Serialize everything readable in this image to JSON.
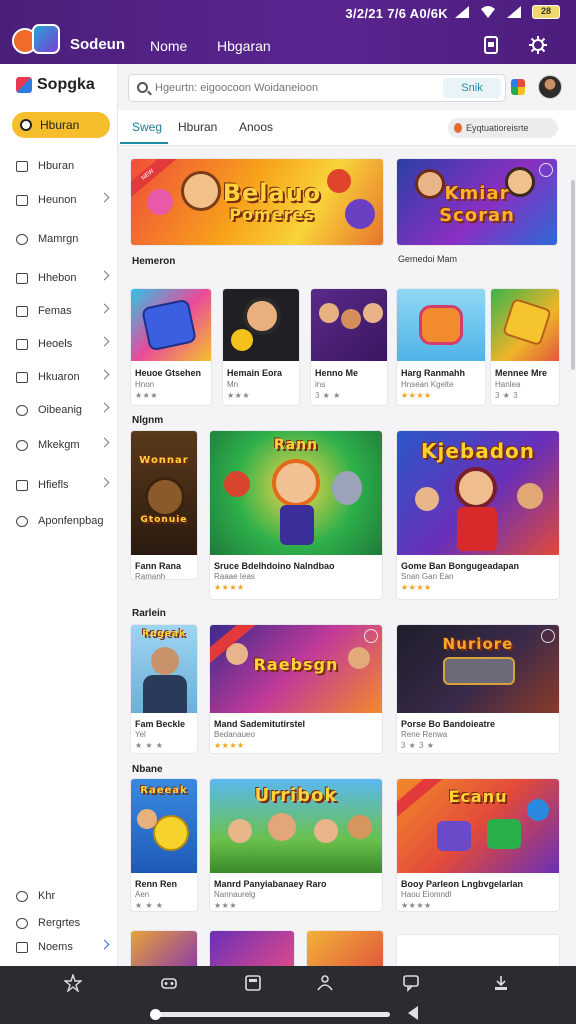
{
  "status": {
    "time_text": "3/2/21 7/6 A0/6K",
    "battery": "28"
  },
  "header": {
    "app_title": "Sodeun",
    "nav": [
      "Nome",
      "Hbgaran"
    ]
  },
  "sidebar": {
    "brand": "Sopgka",
    "home": "Hburan",
    "items": [
      {
        "label": "Hburan",
        "chevron": false
      },
      {
        "label": "Heunon",
        "chevron": true
      },
      {
        "label": "Mamrgn",
        "chevron": false
      },
      {
        "label": "Hhebon",
        "chevron": true
      },
      {
        "label": "Femas",
        "chevron": true
      },
      {
        "label": "Heoels",
        "chevron": true
      },
      {
        "label": "Hkuaron",
        "chevron": true
      },
      {
        "label": "Oibeanig",
        "chevron": true
      },
      {
        "label": "Mkekgm",
        "chevron": true
      },
      {
        "label": "Hfiefls",
        "chevron": true
      },
      {
        "label": "Aponfenpbag",
        "chevron": false
      }
    ],
    "bottom_items": [
      "Khr",
      "Rergrtes",
      "Noems"
    ]
  },
  "search": {
    "placeholder": "Hgeurtn: eigoocoon Woidaneioon",
    "button": "Snik"
  },
  "tabs": [
    "Sweg",
    "Hburan",
    "Anoos"
  ],
  "filter_chip": "Eyqtuatioreisrte",
  "featured": {
    "left": {
      "art_text": [
        "Belauo",
        "Pomeres"
      ],
      "badge": "NEW",
      "caption": "Hemeron"
    },
    "right": {
      "art_text": [
        "Kmiar",
        "Scoran"
      ],
      "caption": "Gemedoi Mam"
    }
  },
  "row1": [
    {
      "title": "Heuoe Gtsehen",
      "sub": "Hnon",
      "stars": "★★★"
    },
    {
      "title": "Hemain Eora",
      "sub": "Mn",
      "stars": "★★★"
    },
    {
      "title": "Henno Me",
      "sub": "ins",
      "stars": "3 ★ ★"
    },
    {
      "title": "Harg Ranmahh",
      "sub": "Hnsean Kgelte",
      "stars": "★★★★"
    },
    {
      "title": "Mennee Mre",
      "sub": "Hanlea",
      "stars": "3 ★ 3"
    }
  ],
  "section2": "Nlgnm",
  "row2": [
    {
      "art_text": "Wonnar",
      "art_text2": "Gtonuie",
      "title": "Fann Rana",
      "sub": "Ramanh",
      "stars": "★★★"
    },
    {
      "art_text": "Rann",
      "title": "Sruce Bdelhdoino Nalndbao",
      "sub": "Raaae Ieas",
      "stars": "★★★★"
    },
    {
      "art_text": "Kjebadon",
      "title": "Gome Ban Bongugeadapan",
      "sub": "Snan Gan Ean",
      "stars": "★★★★"
    }
  ],
  "section3": "Rarlein",
  "row3": [
    {
      "art_text": "Rogeak",
      "title": "Fam Beckle",
      "sub": "Yel",
      "stars": "★ ★ ★"
    },
    {
      "art_text": "Raebsgn",
      "title": "Mand Sademitutirstel",
      "sub": "Bedanaueo",
      "stars": "★★★★"
    },
    {
      "art_text": "Nuriore",
      "title": "Porse Bo Bandoieatre",
      "sub": "Rene Renwa",
      "stars": "3 ★ 3 ★"
    }
  ],
  "section4": "Nbane",
  "row4": [
    {
      "art_text": "Raeeak",
      "title": "Renn Ren",
      "sub": "Aen",
      "stars": "★ ★ ★"
    },
    {
      "art_text": "Urribok",
      "title": "Manrd Panyiabanaey Raro",
      "sub": "Nannaurelg",
      "stars": "★★★"
    },
    {
      "art_text": "Ecanu",
      "title": "Booy Parleon Lngbvgelarlan",
      "sub": "Haou Eiomndl",
      "stars": "★★★★"
    }
  ],
  "colors": {
    "header": "#4a1f7a",
    "accent": "#1d7e93",
    "home_pill": "#f6be2c",
    "star": "#f2a31b"
  }
}
